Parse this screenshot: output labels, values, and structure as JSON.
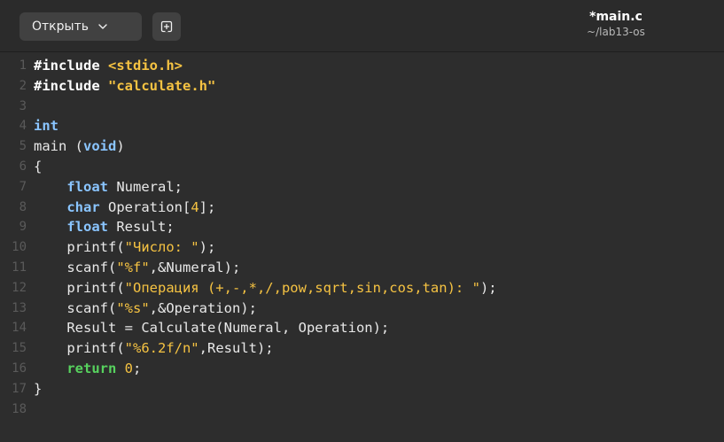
{
  "header": {
    "open_label": "Открыть",
    "title": "*main.c",
    "subtitle": "~/lab13-os"
  },
  "line_numbers": [
    "1",
    "2",
    "3",
    "4",
    "5",
    "6",
    "7",
    "8",
    "9",
    "10",
    "11",
    "12",
    "13",
    "14",
    "15",
    "16",
    "17",
    "18"
  ],
  "code": {
    "l1_pre": "#include ",
    "l1_inc": "<stdio.h>",
    "l2_pre": "#include ",
    "l2_inc": "\"calculate.h\"",
    "l4_kw": "int",
    "l5_a": "main (",
    "l5_kw": "void",
    "l5_b": ")",
    "l6": "{",
    "l7_ind": "    ",
    "l7_kw": "float",
    "l7_rest": " Numeral;",
    "l8_ind": "    ",
    "l8_kw": "char",
    "l8_a": " Operation[",
    "l8_num": "4",
    "l8_b": "];",
    "l9_ind": "    ",
    "l9_kw": "float",
    "l9_rest": " Result;",
    "l10_a": "    printf(",
    "l10_str": "\"Число: \"",
    "l10_b": ");",
    "l11_a": "    scanf(",
    "l11_str": "\"%f\"",
    "l11_b": ",&Numeral);",
    "l12_a": "    printf(",
    "l12_str": "\"Операция (+,-,*,/,pow,sqrt,sin,cos,tan): \"",
    "l12_b": ");",
    "l13_a": "    scanf(",
    "l13_str": "\"%s\"",
    "l13_b": ",&Operation);",
    "l14": "    Result = Calculate(Numeral, Operation);",
    "l15_a": "    printf(",
    "l15_str": "\"%6.2f/n\"",
    "l15_b": ",Result);",
    "l16_ind": "    ",
    "l16_kw": "return",
    "l16_sp": " ",
    "l16_num": "0",
    "l16_b": ";",
    "l17": "}"
  },
  "icons": {
    "open_chevron": "chevron-down-icon",
    "new_tab": "new-document-icon"
  }
}
